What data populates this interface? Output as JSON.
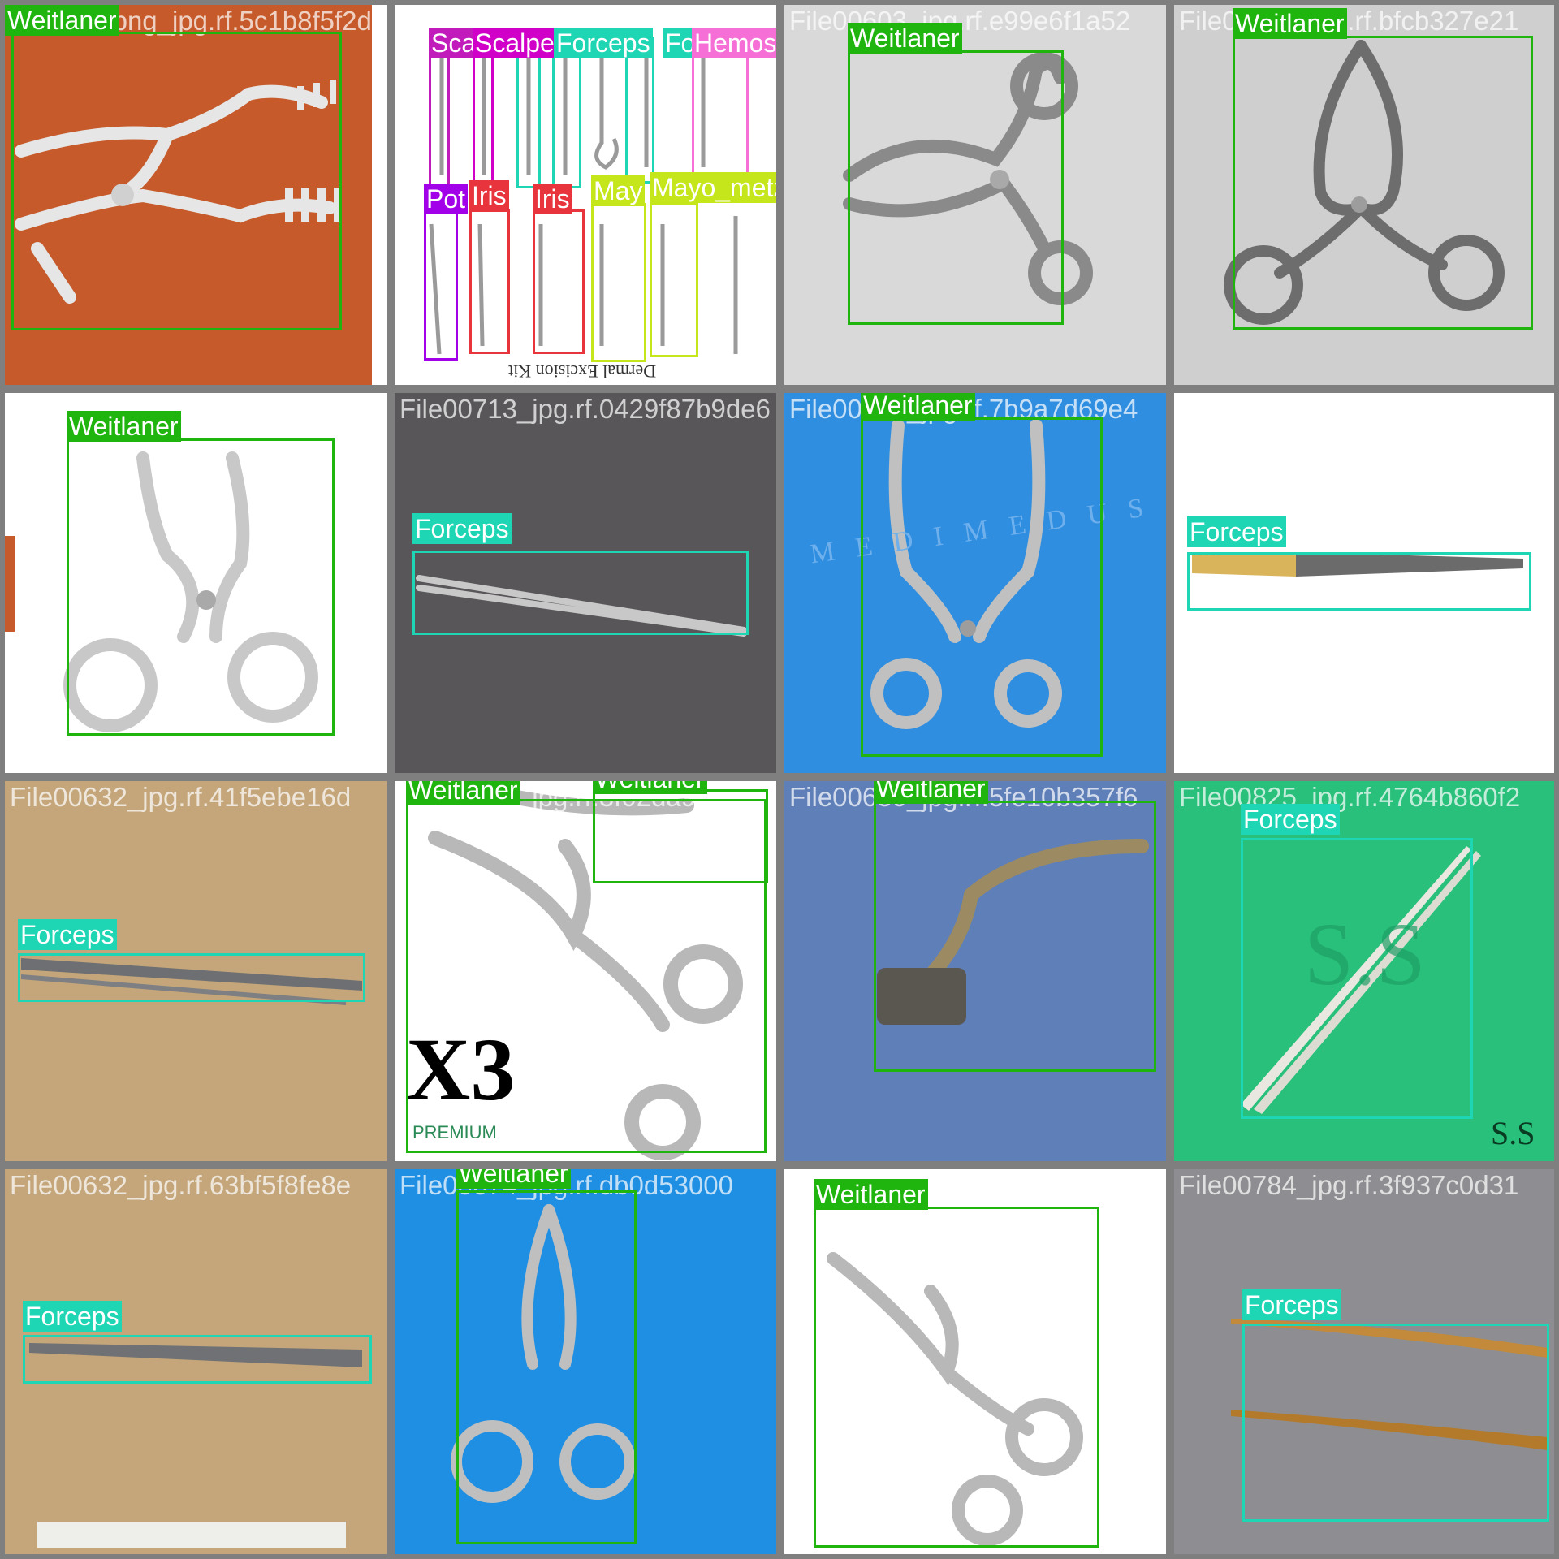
{
  "colors": {
    "Weitlaner": "#1fb50e",
    "Forceps": "#1ed6b4",
    "Scalpel": "#d100c8",
    "Scalpel_small": "#c21bbc",
    "Hemostat": "#f56fd6",
    "Potts": "#a100e8",
    "Iris": "#e8343d",
    "Mayo_metz": "#c6e61c",
    "grid_gap": "#7f7f7f"
  },
  "tiles": [
    {
      "filename": "File006_png_jpg.rf.5c1b8f5f2d1430288c1cf4d1a47e1cd1f1",
      "bg": "#c65a2a",
      "labels": [
        "Weitlaner"
      ]
    },
    {
      "filename": "File0021_jpg.rf.4b4f1c3d8a",
      "bg": "#ffffff",
      "labels": [
        "Sca",
        "Scalpel",
        "Forceps",
        "Fo",
        "Hemostat",
        "Pot",
        "Iris",
        "Iris",
        "May",
        "Mayo_metz"
      ],
      "caption": "Dermal Excision Kit"
    },
    {
      "filename": "File00603_jpg.rf.e99e6f1a52",
      "bg": "#d9d9d9",
      "labels": [
        "Weitlaner"
      ]
    },
    {
      "filename": "File00612_jpg.rf.bfcb327e21",
      "bg": "#cfcfcf",
      "labels": [
        "Weitlaner"
      ]
    },
    {
      "filename": "File00599_jpg.rf.af70e899c55a",
      "bg": "#ffffff",
      "labels": [
        "Weitlaner"
      ]
    },
    {
      "filename": "File00713_jpg.rf.0429f87b9de6",
      "bg": "#59565a",
      "labels": [
        "Forceps"
      ]
    },
    {
      "filename": "File00542_jpg.rf.7b9a7d69e4",
      "bg": "#2f8ee0",
      "labels": [
        "Weitlaner"
      ],
      "watermark": "MEDIMEDUS"
    },
    {
      "filename": "File00761_jpg.rf.16ff870fd971",
      "bg": "#ffffff",
      "labels": [
        "Forceps"
      ]
    },
    {
      "filename": "File00632_jpg.rf.41f5ebe16d",
      "bg": "#c4a67a",
      "labels": [
        "Forceps"
      ]
    },
    {
      "filename": "File00571_jpg.rf.3f02da92b1",
      "bg": "#ffffff",
      "labels": [
        "Weitlaner",
        "Weitlaner"
      ],
      "badge": "X3",
      "brand": "PREMIUM"
    },
    {
      "filename": "File00630_jpg.rf.5fe10b357f6",
      "bg": "#5f7fb8",
      "labels": [
        "Weitlaner"
      ]
    },
    {
      "filename": "File00825_jpg.rf.4764b860f2",
      "bg": "#28c07a",
      "labels": [
        "Forceps"
      ],
      "watermark": "S.S",
      "brand": "S.S"
    },
    {
      "filename": "File00632_jpg.rf.63bf5f8fe8e",
      "bg": "#c4a67a",
      "labels": [
        "Forceps"
      ]
    },
    {
      "filename": "File00674_jpg.rf.db0d53000",
      "bg": "#1f8fe3",
      "labels": [
        "Weitlaner"
      ]
    },
    {
      "filename": "File00470_jpg.rf.f89966759d",
      "bg": "#ffffff",
      "labels": [
        "Weitlaner"
      ]
    },
    {
      "filename": "File00784_jpg.rf.3f937c0d31",
      "bg": "#8e8e92",
      "labels": [
        "Forceps"
      ]
    }
  ]
}
